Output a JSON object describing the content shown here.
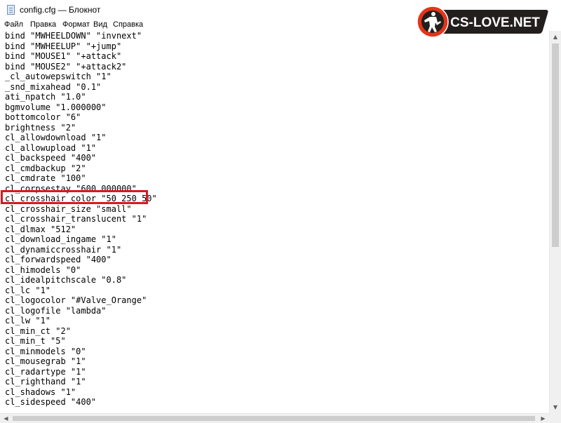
{
  "window": {
    "title": "config.cfg — Блокнот"
  },
  "brand": {
    "text": "CS-LOVE.NET",
    "colors": {
      "accent": "#e4341b",
      "panel": "#231f1c",
      "text": "#ffffff"
    }
  },
  "menu": {
    "items": [
      "Файл",
      "Правка",
      "Формат",
      "Вид",
      "Справка"
    ]
  },
  "editor": {
    "lines": [
      "bind \"MWHEELDOWN\" \"invnext\"",
      "bind \"MWHEELUP\" \"+jump\"",
      "bind \"MOUSE1\" \"+attack\"",
      "bind \"MOUSE2\" \"+attack2\"",
      "_cl_autowepswitch \"1\"",
      "_snd_mixahead \"0.1\"",
      "ati_npatch \"1.0\"",
      "bgmvolume \"1.000000\"",
      "bottomcolor \"6\"",
      "brightness \"2\"",
      "cl_allowdownload \"1\"",
      "cl_allowupload \"1\"",
      "cl_backspeed \"400\"",
      "cl_cmdbackup \"2\"",
      "cl_cmdrate \"100\"",
      "cl_corpsestay \"600.000000\"",
      "cl_crosshair_color \"50 250 50\"",
      "cl_crosshair_size \"small\"",
      "cl_crosshair_translucent \"1\"",
      "cl_dlmax \"512\"",
      "cl_download_ingame \"1\"",
      "cl_dynamiccrosshair \"1\"",
      "cl_forwardspeed \"400\"",
      "cl_himodels \"0\"",
      "cl_idealpitchscale \"0.8\"",
      "cl_lc \"1\"",
      "cl_logocolor \"#Valve_Orange\"",
      "cl_logofile \"lambda\"",
      "cl_lw \"1\"",
      "cl_min_ct \"2\"",
      "cl_min_t \"5\"",
      "cl_minmodels \"0\"",
      "cl_mousegrab \"1\"",
      "cl_radartype \"1\"",
      "cl_righthand \"1\"",
      "cl_shadows \"1\"",
      "cl_sidespeed \"400\""
    ],
    "highlight_color": "#d7191f",
    "highlighted_line": "cl_crosshair_color \"50 250 50\""
  },
  "scrollbars": {
    "up_icon": "triangle-up",
    "down_icon": "triangle-down",
    "left_icon": "triangle-left",
    "right_icon": "triangle-right"
  }
}
